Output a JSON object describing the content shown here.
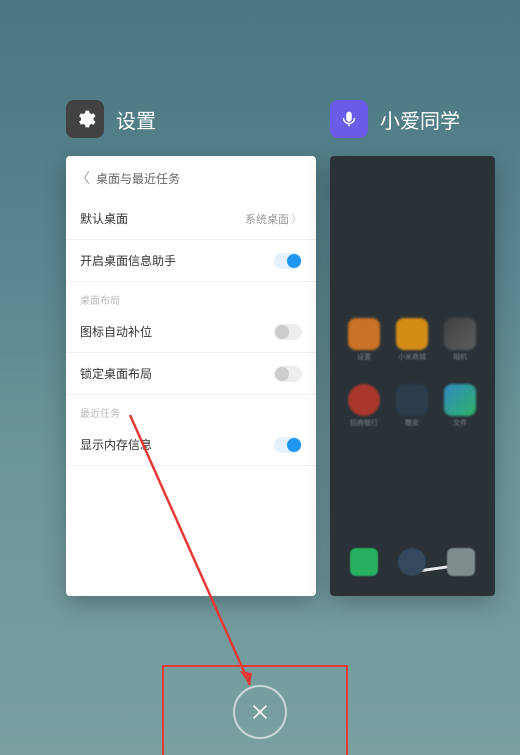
{
  "apps": {
    "settings": {
      "title": "设置"
    },
    "xiaoai": {
      "title": "小爱同学"
    }
  },
  "settings_card": {
    "header_title": "桌面与最近任务",
    "rows": {
      "default_launcher": {
        "label": "默认桌面",
        "value": "系统桌面"
      },
      "info_assistant": {
        "label": "开启桌面信息助手"
      },
      "section_layout": "桌面布局",
      "auto_fill": {
        "label": "图标自动补位"
      },
      "lock_layout": {
        "label": "锁定桌面布局"
      },
      "section_recent": "最近任务",
      "show_memory": {
        "label": "显示内存信息"
      }
    }
  }
}
